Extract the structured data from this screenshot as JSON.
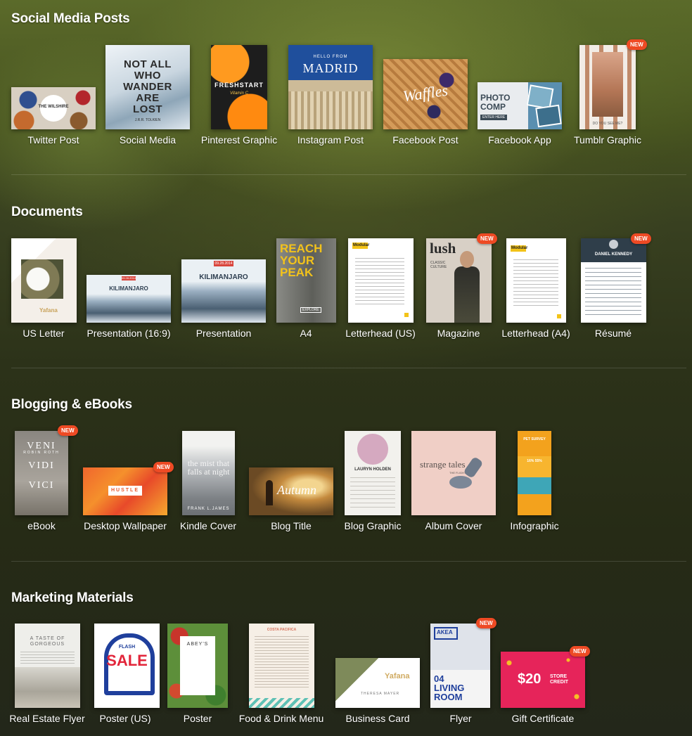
{
  "sections": [
    {
      "title": "Social Media Posts",
      "items": [
        {
          "label": "Twitter Post",
          "thumb_text": "THE WILSHIRE"
        },
        {
          "label": "Social Media",
          "thumb_text": "NOT ALL WHO WANDER ARE LOST",
          "thumb_sub": "J.R.R. TOLKIEN"
        },
        {
          "label": "Pinterest Graphic",
          "thumb_text": "FRESHSTART",
          "thumb_sub": "Vitamin C"
        },
        {
          "label": "Instagram Post",
          "thumb_text": "MADRID",
          "thumb_sub": "HELLO FROM"
        },
        {
          "label": "Facebook Post",
          "thumb_text": "Waffles"
        },
        {
          "label": "Facebook App",
          "thumb_text": "PHOTO COMP",
          "thumb_sub": "ENTER HERE"
        },
        {
          "label": "Tumblr Graphic",
          "thumb_sub": "DO YOU SEE ME?",
          "badge": "NEW"
        }
      ]
    },
    {
      "title": "Documents",
      "items": [
        {
          "label": "US Letter",
          "thumb_text": "Yafana"
        },
        {
          "label": "Presentation (16:9)",
          "thumb_text": "KILIMANJARO",
          "thumb_sub": "09.28.2014"
        },
        {
          "label": "Presentation",
          "thumb_text": "KILIMANJARO",
          "thumb_sub": "09.28.2014"
        },
        {
          "label": "A4",
          "thumb_text": "REACH YOUR PEAK",
          "thumb_sub": "EXPLORE"
        },
        {
          "label": "Letterhead (US)",
          "thumb_text": "Modular"
        },
        {
          "label": "Magazine",
          "thumb_text": "lush",
          "thumb_sub": "CLASSIC CULTURE",
          "badge": "NEW"
        },
        {
          "label": "Letterhead (A4)",
          "thumb_text": "Modular"
        },
        {
          "label": "Résumé",
          "thumb_text": "DANIEL KENNEDY",
          "badge": "NEW"
        }
      ]
    },
    {
      "title": "Blogging & eBooks",
      "items": [
        {
          "label": "eBook",
          "thumb_text": "VENI VIDI VICI",
          "thumb_sub": "ROBIN ROTH",
          "badge": "NEW"
        },
        {
          "label": "Desktop Wallpaper",
          "thumb_text": "HUSTLE",
          "badge": "NEW"
        },
        {
          "label": "Kindle Cover",
          "thumb_text": "the mist that falls at night",
          "thumb_sub": "FRANK L.JAMES"
        },
        {
          "label": "Blog Title",
          "thumb_text": "Autumn"
        },
        {
          "label": "Blog Graphic",
          "thumb_text": "LAURYN HOLDEN"
        },
        {
          "label": "Album Cover",
          "thumb_text": "strange tales",
          "thumb_sub": "THE FLIGHT"
        },
        {
          "label": "Infographic",
          "thumb_text": "PET SURVEY",
          "thumb_sub": "16%  55%"
        }
      ]
    },
    {
      "title": "Marketing Materials",
      "items": [
        {
          "label": "Real Estate Flyer",
          "thumb_text": "A TASTE OF GORGEOUS"
        },
        {
          "label": "Poster (US)",
          "thumb_text": "SALE",
          "thumb_sub": "FLASH"
        },
        {
          "label": "Poster",
          "thumb_text": "ABEY'S"
        },
        {
          "label": "Food & Drink Menu",
          "thumb_text": "COSTA PACIFICA"
        },
        {
          "label": "Business Card",
          "thumb_text": "Yafana",
          "thumb_sub": "THERESA MAYER"
        },
        {
          "label": "Flyer",
          "thumb_text": "04 LIVING ROOM",
          "thumb_sub": "AKEA",
          "badge": "NEW"
        },
        {
          "label": "Gift Certificate",
          "thumb_text": "$20",
          "thumb_sub": "STORE CREDIT",
          "badge": "NEW"
        }
      ]
    }
  ]
}
